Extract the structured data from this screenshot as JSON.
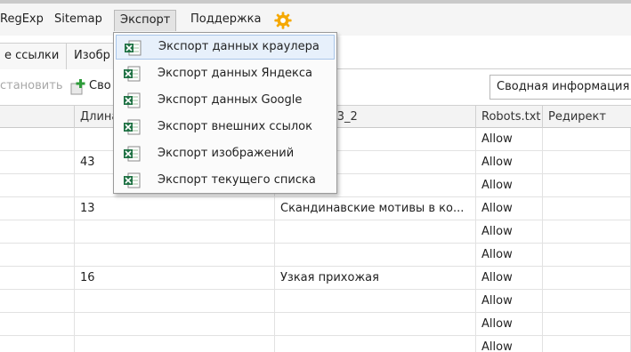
{
  "menu": {
    "items": [
      {
        "label": "RegExp"
      },
      {
        "label": "Sitemap"
      },
      {
        "label": "Экспорт"
      },
      {
        "label": "Поддержка"
      }
    ],
    "settings_icon": "gear-icon"
  },
  "tabs": [
    {
      "label": "е ссылки"
    },
    {
      "label": "Изобр"
    }
  ],
  "toolbar": {
    "restore_label": "становить",
    "add_label": "Сво",
    "add_icon": "green-plus-icon",
    "summary_value": "Сводная информация"
  },
  "export_menu": {
    "icon": "excel-icon",
    "items": [
      {
        "label": "Экспорт данных краулера"
      },
      {
        "label": "Экспорт данных Яндекса"
      },
      {
        "label": "Экспорт данных Google"
      },
      {
        "label": "Экспорт внешних ссылок"
      },
      {
        "label": "Экспорт изображений"
      },
      {
        "label": "Экспорт текущего списка"
      }
    ]
  },
  "grid": {
    "headers": [
      "Длина",
      "H3_2",
      "Robots.txt",
      "Редирект"
    ],
    "rows": [
      {
        "length": "",
        "h3": "",
        "robots": "Allow"
      },
      {
        "length": "43",
        "h3": "",
        "robots": "Allow"
      },
      {
        "length": "",
        "h3": "",
        "robots": "Allow"
      },
      {
        "length": "13",
        "h3": "Скандинавские мотивы в ко...",
        "robots": "Allow"
      },
      {
        "length": "",
        "h3": "",
        "robots": "Allow"
      },
      {
        "length": "",
        "h3": "",
        "robots": "Allow"
      },
      {
        "length": "16",
        "h3": "Узкая прихожая",
        "robots": "Allow"
      },
      {
        "length": "",
        "h3": "",
        "robots": "Allow"
      },
      {
        "length": "",
        "h3": "",
        "robots": "Allow"
      },
      {
        "length": "",
        "h3": "",
        "robots": "Allow"
      }
    ]
  },
  "colors": {
    "gear": "#f5a800",
    "excel_green": "#217346",
    "highlight": "#e7f0fb"
  }
}
